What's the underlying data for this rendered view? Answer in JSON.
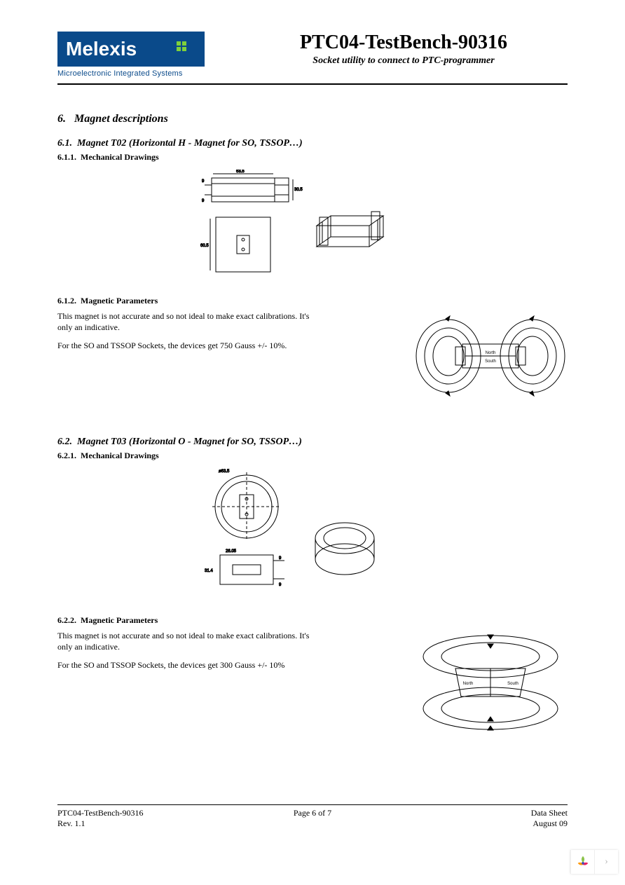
{
  "header": {
    "logo_text": "Melexis",
    "logo_tagline": "Microelectronic Integrated Systems",
    "title": "PTC04-TestBench-90316",
    "subtitle": "Socket utility to connect to PTC-programmer"
  },
  "section6": {
    "number": "6.",
    "title": "Magnet descriptions"
  },
  "section6_1": {
    "number": "6.1.",
    "title": "Magnet T02 (Horizontal H - Magnet for SO, TSSOP…)",
    "s6_1_1": {
      "number": "6.1.1.",
      "title": "Mechanical Drawings",
      "dimensions": {
        "width": "63.5",
        "height": "30.5",
        "depth": "60.5",
        "thickness": "9"
      }
    },
    "s6_1_2": {
      "number": "6.1.2.",
      "title": "Magnetic Parameters",
      "p1": "This magnet is not accurate and so not ideal to make exact calibrations. It's only an indicative.",
      "p2": "For the SO and TSSOP Sockets, the devices get 750 Gauss +/- 10%.",
      "diagram_labels": {
        "top": "North",
        "bottom": "South"
      }
    }
  },
  "section6_2": {
    "number": "6.2.",
    "title": "Magnet T03 (Horizontal O - Magnet for SO, TSSOP…)",
    "s6_2_1": {
      "number": "6.2.1.",
      "title": "Mechanical Drawings",
      "dimensions": {
        "outer_diameter": "ø63.5",
        "height": "31.4",
        "bore_width": "26.05",
        "thickness": "9"
      }
    },
    "s6_2_2": {
      "number": "6.2.2.",
      "title": "Magnetic Parameters",
      "p1": "This magnet is not accurate and so not ideal to make exact calibrations. It's only an indicative.",
      "p2": "For the SO and TSSOP Sockets, the devices get 300 Gauss +/- 10%",
      "diagram_labels": {
        "left": "North",
        "right": "South"
      }
    }
  },
  "footer": {
    "left_top": "PTC04-TestBench-90316",
    "left_bottom": "Rev. 1.1",
    "center": "Page 6 of 7",
    "right_top": "Data Sheet",
    "right_bottom": "August 09"
  }
}
